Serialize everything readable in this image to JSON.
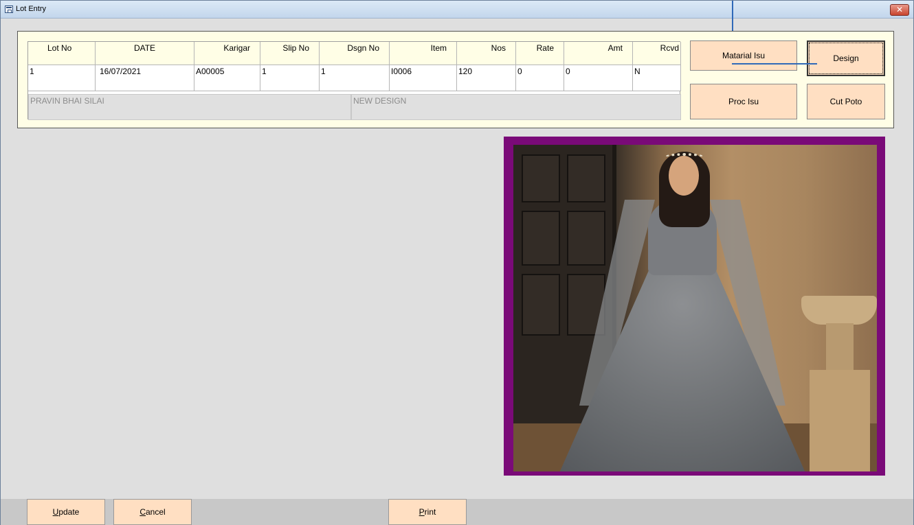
{
  "window": {
    "title": "Lot Entry",
    "close_symbol": "✕"
  },
  "grid": {
    "headers": [
      "Lot No",
      "DATE",
      "Karigar",
      "Slip No",
      "Dsgn No",
      "Item",
      "Nos",
      "Rate",
      "Amt",
      "Rcvd"
    ],
    "row": [
      "1",
      "16/07/2021",
      "A00005",
      "1",
      "1",
      "I0006",
      "120",
      "0",
      "0",
      "N"
    ],
    "karigar_name": "PRAVIN BHAI SILAI",
    "design_name": "NEW DESIGN"
  },
  "buttons": {
    "material_issue": "Matarial Isu",
    "design": "Design",
    "process_issue": "Proc Isu",
    "cut_photo": "Cut Poto"
  },
  "bottom": {
    "update": "Update",
    "cancel": "Cancel",
    "print": "Print"
  },
  "colors": {
    "panel_bg": "#fffee6",
    "button_bg": "#ffdfc2",
    "photo_frame": "#7a0a78",
    "connector": "#2f69b8"
  }
}
